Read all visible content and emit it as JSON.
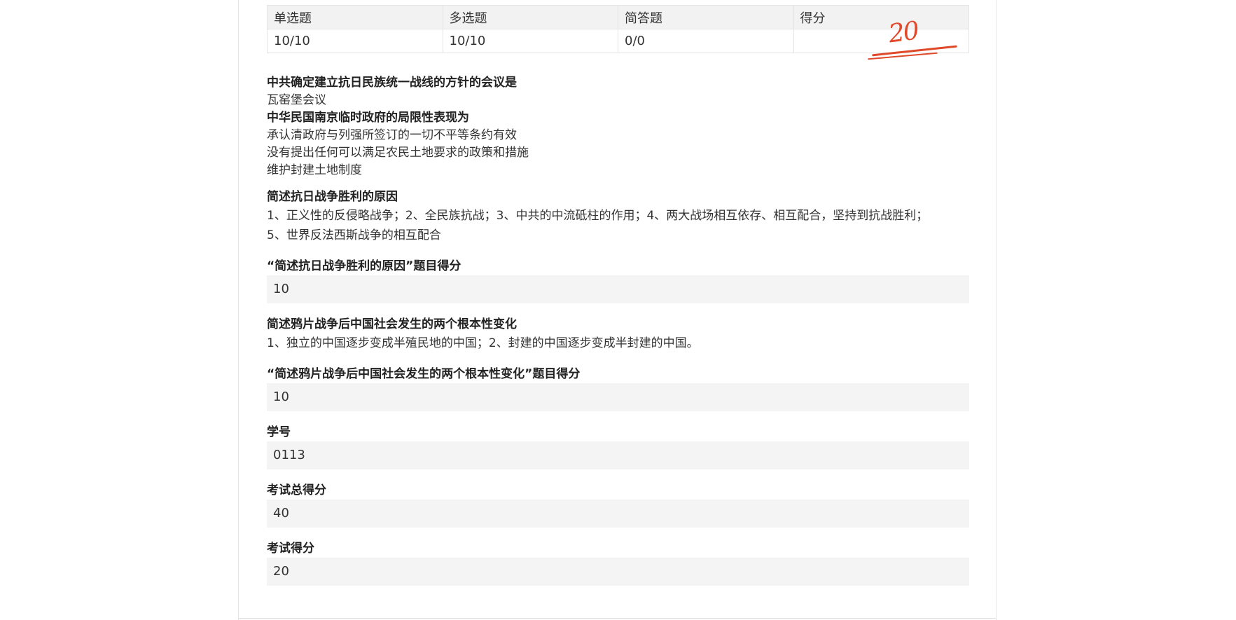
{
  "score_table": {
    "headers": [
      "单选题",
      "多选题",
      "简答题",
      "得分"
    ],
    "values": [
      "10/10",
      "10/10",
      "0/0",
      ""
    ],
    "grade_mark": "20",
    "grade_color": "#e0492a"
  },
  "questions": [
    {
      "q": "中共确定建立抗日民族统一战线的方针的会议是",
      "answers": [
        "瓦窑堡会议"
      ]
    },
    {
      "q": "中华民国南京临时政府的局限性表现为",
      "answers": [
        "承认清政府与列强所签订的一切不平等条约有效",
        "没有提出任何可以满足农民土地要求的政策和措施",
        "维护封建土地制度"
      ]
    }
  ],
  "short_answers": [
    {
      "q": "简述抗日战争胜利的原因",
      "answer_lines": [
        "1、正义性的反侵略战争；2、全民族抗战；3、中共的中流砥柱的作用；4、两大战场相互依存、相互配合，坚持到抗战胜利；",
        "5、世界反法西斯战争的相互配合"
      ],
      "score_label": "“简述抗日战争胜利的原因”题目得分",
      "score": "10"
    },
    {
      "q": "简述鸦片战争后中国社会发生的两个根本性变化",
      "answer_lines": [
        "1、独立的中国逐步变成半殖民地的中国；2、封建的中国逐步变成半封建的中国。"
      ],
      "score_label": "“简述鸦片战争后中国社会发生的两个根本性变化”题目得分",
      "score": "10"
    }
  ],
  "fields": [
    {
      "label": "学号",
      "value": "0113"
    },
    {
      "label": "考试总得分",
      "value": "40"
    },
    {
      "label": "考试得分",
      "value": "20"
    }
  ]
}
